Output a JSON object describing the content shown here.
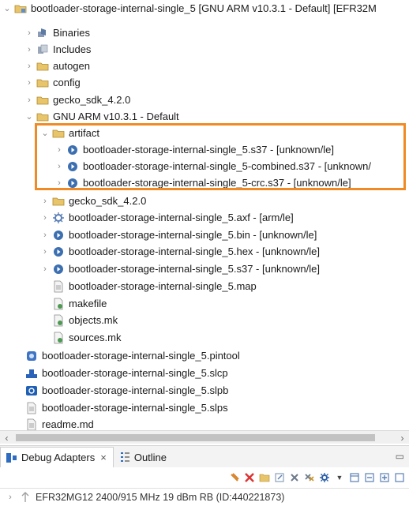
{
  "project_tree": {
    "root": {
      "label": "bootloader-storage-internal-single_5 [GNU ARM v10.3.1 - Default] [EFR32M",
      "expanded": true,
      "icon": "project-folder-icon"
    },
    "items": [
      {
        "label": "Binaries",
        "expanded": false,
        "icon": "binaries-icon"
      },
      {
        "label": "Includes",
        "expanded": false,
        "icon": "includes-icon"
      },
      {
        "label": "autogen",
        "expanded": false,
        "icon": "folder-icon"
      },
      {
        "label": "config",
        "expanded": false,
        "icon": "folder-icon"
      },
      {
        "label": "gecko_sdk_4.2.0",
        "expanded": false,
        "icon": "folder-icon"
      },
      {
        "label": "GNU ARM v10.3.1 - Default",
        "expanded": true,
        "icon": "folder-icon"
      },
      {
        "label": "artifact",
        "expanded": true,
        "icon": "folder-icon"
      },
      {
        "label": "bootloader-storage-internal-single_5.s37 - [unknown/le]",
        "expanded": false,
        "icon": "binary-file-icon"
      },
      {
        "label": "bootloader-storage-internal-single_5-combined.s37 - [unknown/",
        "expanded": false,
        "icon": "binary-file-icon"
      },
      {
        "label": "bootloader-storage-internal-single_5-crc.s37 - [unknown/le]",
        "expanded": false,
        "icon": "binary-file-icon"
      },
      {
        "label": "gecko_sdk_4.2.0",
        "expanded": false,
        "icon": "folder-icon"
      },
      {
        "label": "bootloader-storage-internal-single_5.axf - [arm/le]",
        "expanded": false,
        "icon": "executable-icon"
      },
      {
        "label": "bootloader-storage-internal-single_5.bin - [unknown/le]",
        "expanded": false,
        "icon": "binary-file-icon"
      },
      {
        "label": "bootloader-storage-internal-single_5.hex - [unknown/le]",
        "expanded": false,
        "icon": "binary-file-icon"
      },
      {
        "label": "bootloader-storage-internal-single_5.s37 - [unknown/le]",
        "expanded": false,
        "icon": "binary-file-icon"
      },
      {
        "label": "bootloader-storage-internal-single_5.map",
        "icon": "text-file-icon"
      },
      {
        "label": "makefile",
        "icon": "makefile-icon"
      },
      {
        "label": "objects.mk",
        "icon": "makefile-icon"
      },
      {
        "label": "sources.mk",
        "icon": "makefile-icon"
      },
      {
        "label": "bootloader-storage-internal-single_5.pintool",
        "icon": "pintool-icon"
      },
      {
        "label": "bootloader-storage-internal-single_5.slcp",
        "icon": "slcp-icon"
      },
      {
        "label": "bootloader-storage-internal-single_5.slpb",
        "icon": "slpb-icon"
      },
      {
        "label": "bootloader-storage-internal-single_5.slps",
        "icon": "text-file-icon"
      },
      {
        "label": "readme.md",
        "icon": "text-file-icon"
      }
    ]
  },
  "highlight_color": "#f08a24",
  "bottom_panel": {
    "tabs": [
      {
        "label": "Debug Adapters",
        "close": "×",
        "active": true,
        "icon": "debug-adapters-icon"
      },
      {
        "label": "Outline",
        "active": false,
        "icon": "outline-icon"
      }
    ],
    "device": {
      "label": "EFR32MG12 2400/915 MHz 19 dBm RB (ID:440221873)",
      "icon": "device-icon"
    }
  }
}
